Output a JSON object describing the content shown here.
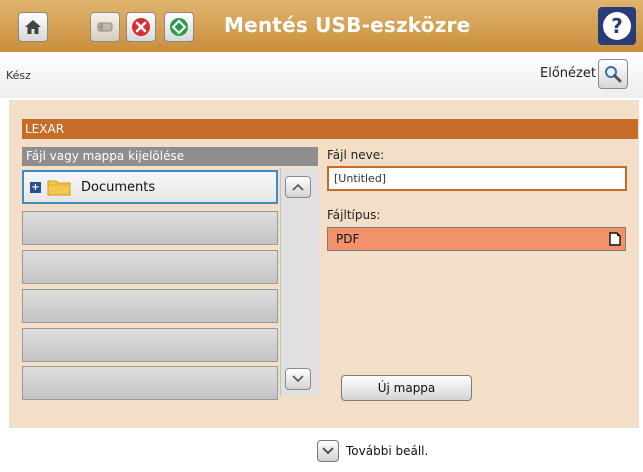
{
  "header": {
    "title": "Mentés USB-eszközre",
    "buttons": [
      "home-icon",
      "back-icon",
      "stop-icon",
      "start-icon"
    ],
    "help_icon": "?",
    "bar_color": "#d4a052"
  },
  "status": {
    "text": "Kész",
    "preview_label": "Előnézet",
    "preview_icon": "magnifier-icon"
  },
  "device": {
    "name": "LEXAR",
    "color": "#c66b28"
  },
  "file_list": {
    "header": "Fájl vagy mappa kijelölése",
    "items": [
      {
        "label": "Documents",
        "icon": "folder-icon",
        "expand_icon": "plus-icon",
        "selected": true
      },
      {
        "label": ""
      },
      {
        "label": ""
      },
      {
        "label": ""
      },
      {
        "label": ""
      },
      {
        "label": ""
      }
    ]
  },
  "form": {
    "filename_label": "Fájl neve:",
    "filename_value": "[Untitled]",
    "filetype_label": "Fájltípus:",
    "filetype_value": "PDF",
    "new_folder_label": "Új mappa"
  },
  "footer": {
    "more_settings_label": "További beáll."
  }
}
